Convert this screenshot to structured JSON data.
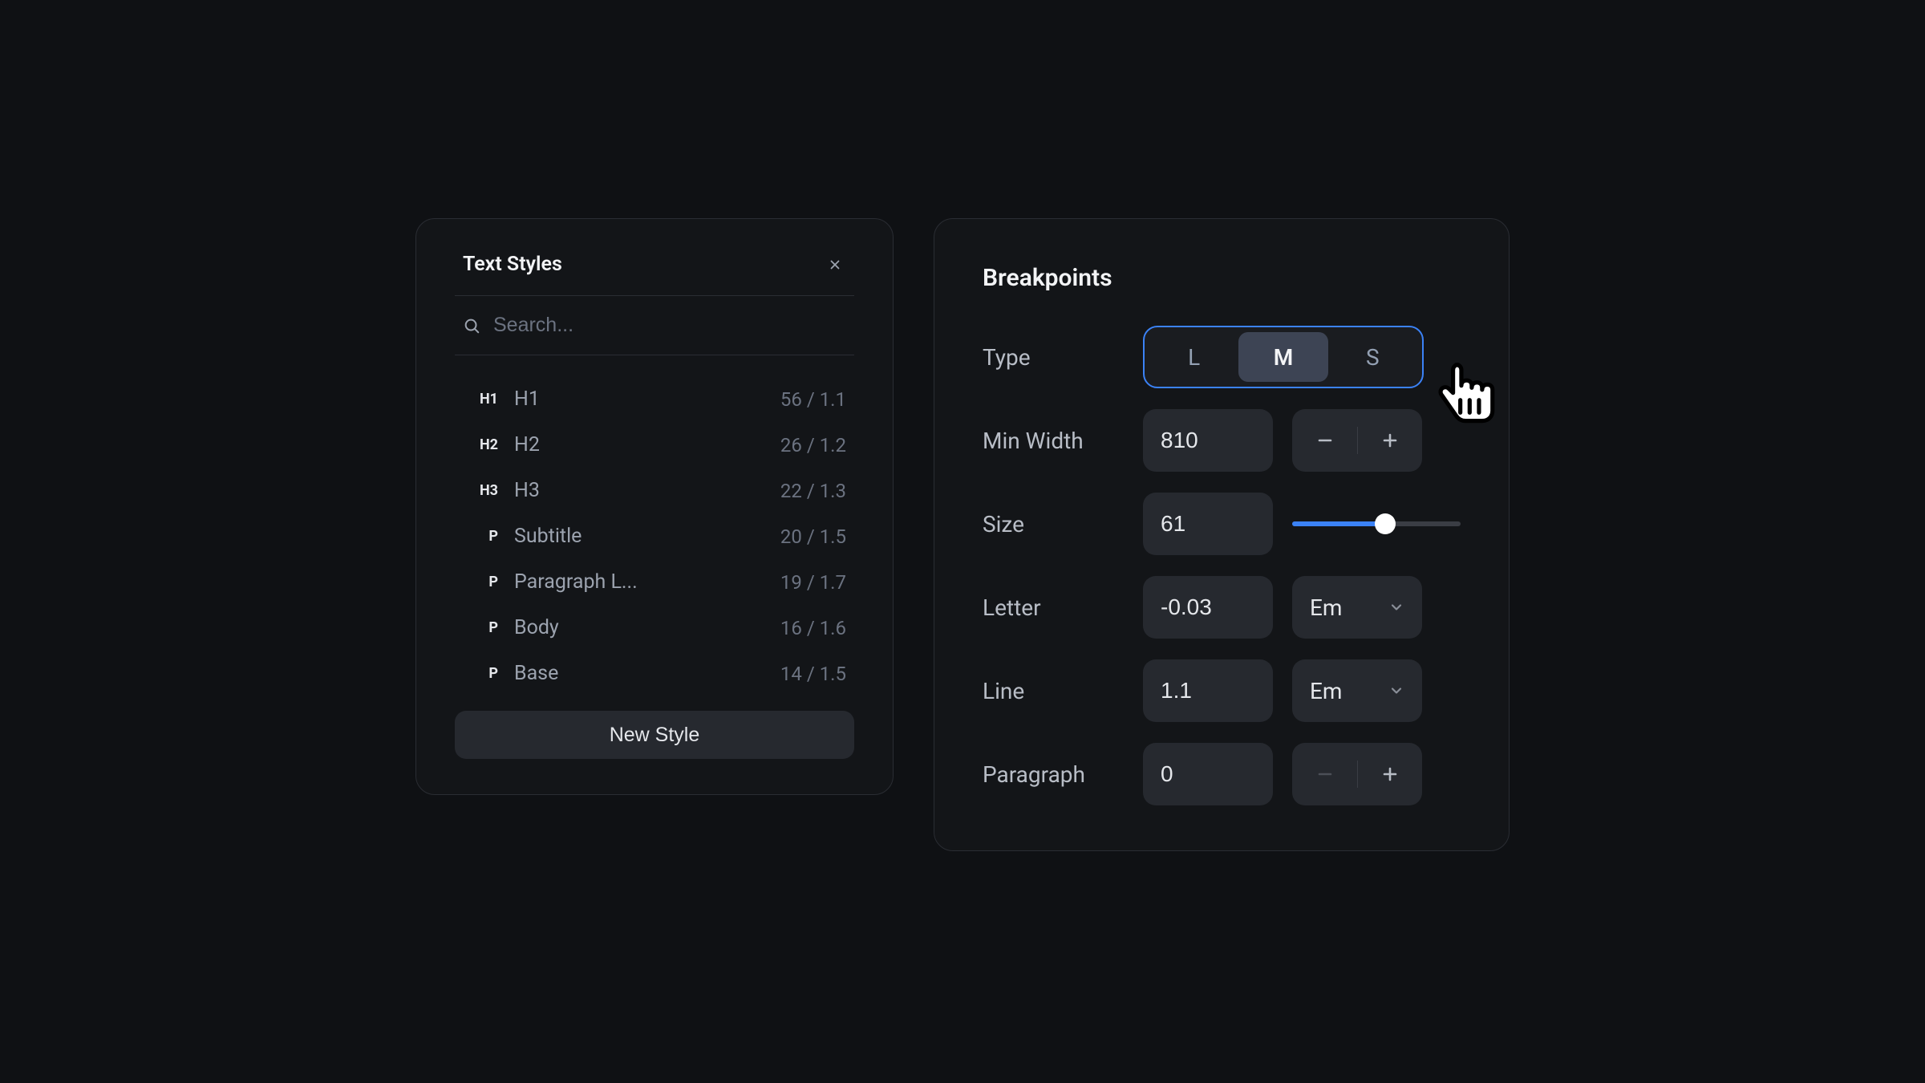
{
  "textStyles": {
    "title": "Text Styles",
    "searchPlaceholder": "Search...",
    "newStyle": "New Style",
    "items": [
      {
        "tag": "H1",
        "name": "H1",
        "meta": "56 / 1.1"
      },
      {
        "tag": "H2",
        "name": "H2",
        "meta": "26 / 1.2"
      },
      {
        "tag": "H3",
        "name": "H3",
        "meta": "22 / 1.3"
      },
      {
        "tag": "P",
        "name": "Subtitle",
        "meta": "20 / 1.5"
      },
      {
        "tag": "P",
        "name": "Paragraph L...",
        "meta": "19 / 1.7"
      },
      {
        "tag": "P",
        "name": "Body",
        "meta": "16 / 1.6"
      },
      {
        "tag": "P",
        "name": "Base",
        "meta": "14 / 1.5"
      }
    ]
  },
  "breakpoints": {
    "title": "Breakpoints",
    "labels": {
      "type": "Type",
      "minWidth": "Min Width",
      "size": "Size",
      "letter": "Letter",
      "line": "Line",
      "paragraph": "Paragraph"
    },
    "type": {
      "options": [
        "L",
        "M",
        "S"
      ],
      "selected": "M"
    },
    "minWidth": "810",
    "size": "61",
    "letter": {
      "value": "-0.03",
      "unit": "Em"
    },
    "line": {
      "value": "1.1",
      "unit": "Em"
    },
    "paragraph": "0"
  }
}
